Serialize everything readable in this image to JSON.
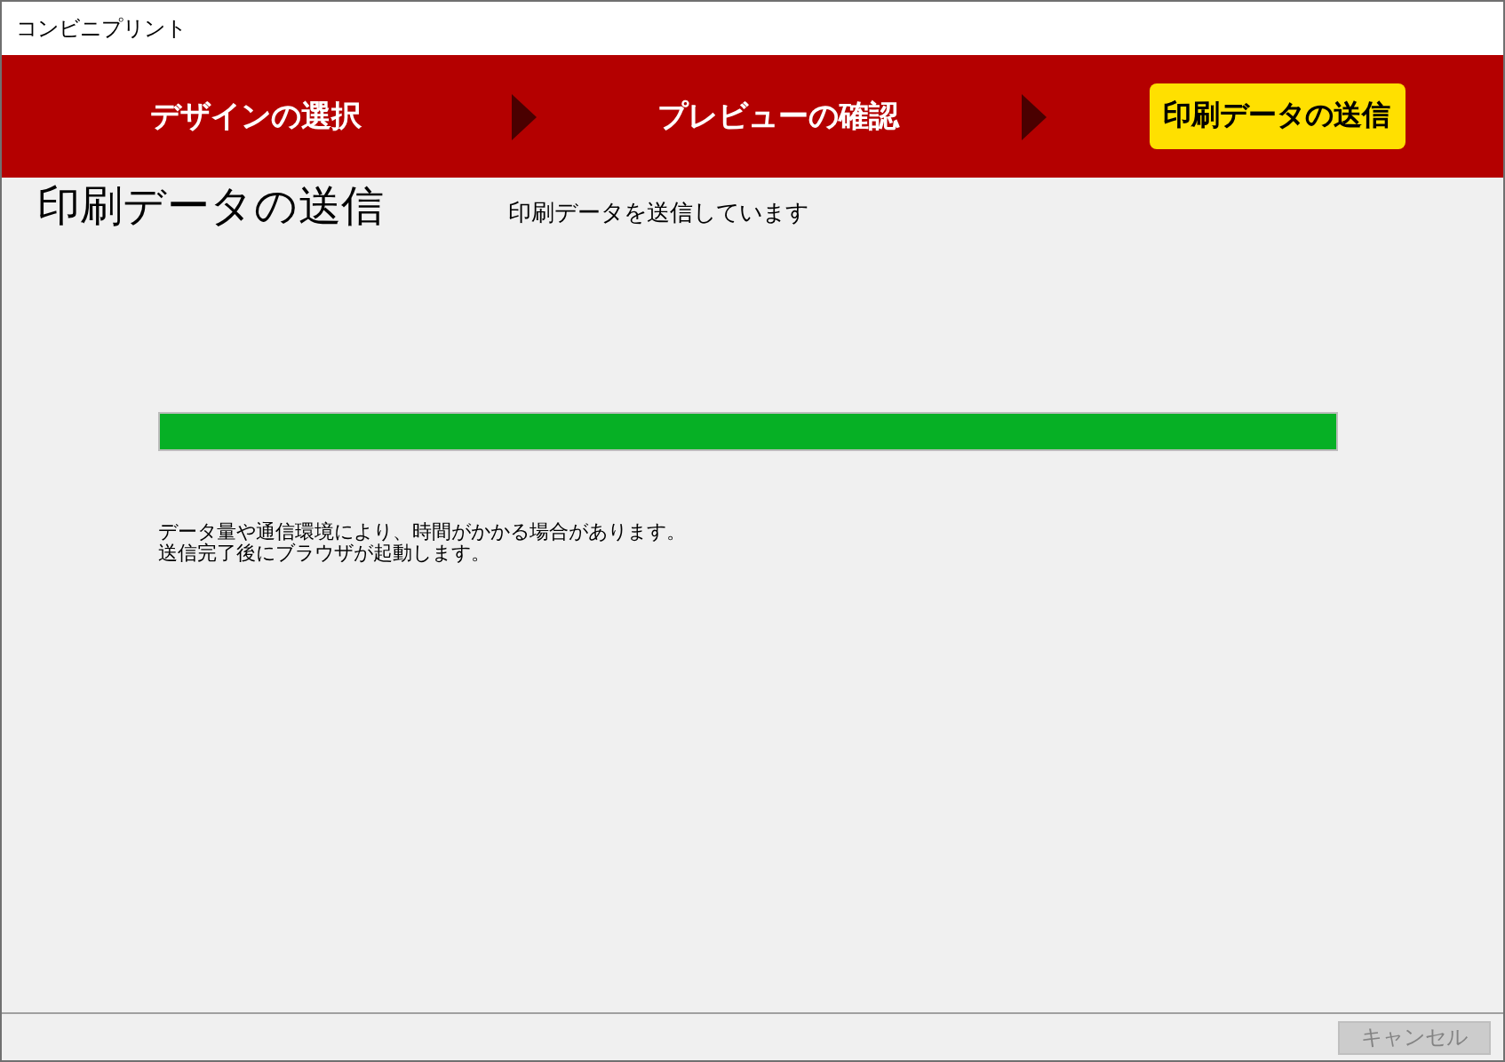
{
  "window": {
    "title": "コンビニプリント"
  },
  "steps": [
    {
      "label": "デザインの選択",
      "selected": false
    },
    {
      "label": "プレビューの確認",
      "selected": false
    },
    {
      "label": "印刷データの送信",
      "selected": true
    }
  ],
  "page": {
    "heading": "印刷データの送信",
    "status": "印刷データを送信しています"
  },
  "progress": {
    "level": 1
  },
  "notes": [
    "データ量や通信環境により、時間がかかる場合があります。",
    "送信完了後にブラウザが起動します。"
  ],
  "buttons": [
    {
      "label": "キャンセル",
      "disabled": true
    }
  ]
}
